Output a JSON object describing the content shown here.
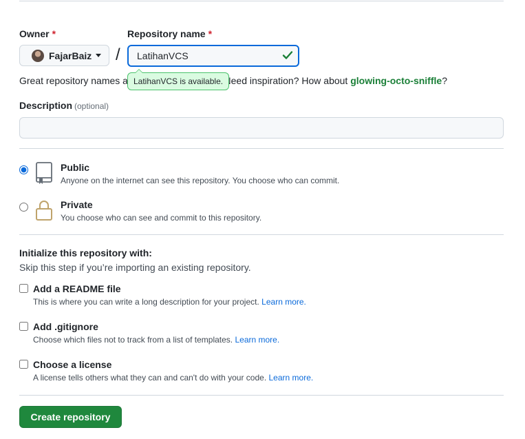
{
  "owner": {
    "label": "Owner",
    "required_mark": "*",
    "value": "FajarBaiz"
  },
  "separator": "/",
  "repo_name": {
    "label": "Repository name",
    "required_mark": "*",
    "value": "LatihanVCS",
    "availability_tooltip": "LatihanVCS is available."
  },
  "hint": {
    "prefix": "Great repository names a",
    "middle": "e. Need inspiration? How about ",
    "suggestion": "glowing-octo-sniffle",
    "suffix": "?"
  },
  "description": {
    "label": "Description",
    "optional": "(optional)",
    "value": "",
    "placeholder": ""
  },
  "visibility": {
    "selected": "public",
    "options": [
      {
        "id": "public",
        "title": "Public",
        "desc": "Anyone on the internet can see this repository. You choose who can commit.",
        "icon": "repo-icon"
      },
      {
        "id": "private",
        "title": "Private",
        "desc": "You choose who can see and commit to this repository.",
        "icon": "lock-icon"
      }
    ]
  },
  "init": {
    "title": "Initialize this repository with:",
    "subtitle": "Skip this step if you’re importing an existing repository.",
    "options": [
      {
        "title": "Add a README file",
        "desc": "This is where you can write a long description for your project.",
        "link": "Learn more.",
        "checked": false
      },
      {
        "title": "Add .gitignore",
        "desc": "Choose which files not to track from a list of templates.",
        "link": "Learn more.",
        "checked": false
      },
      {
        "title": "Choose a license",
        "desc": "A license tells others what they can and can't do with your code.",
        "link": "Learn more.",
        "checked": false
      }
    ]
  },
  "submit": {
    "label": "Create repository"
  },
  "colors": {
    "primary_button": "#1f883d",
    "link": "#0969da",
    "focus": "#0969da",
    "success": "#1a7f37",
    "required": "#cf222e"
  }
}
